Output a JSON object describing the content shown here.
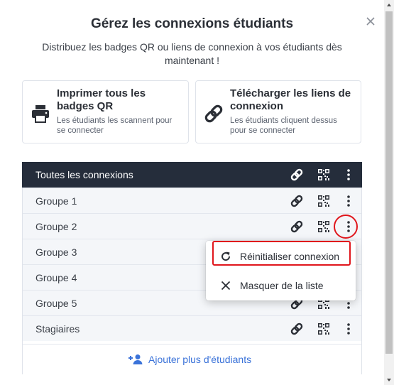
{
  "modal": {
    "title": "Gérez les connexions étudiants",
    "subtitle": "Distribuez les badges QR ou liens de connexion à vos étudiants dès maintenant !"
  },
  "cards": {
    "print": {
      "title": "Imprimer tous les badges QR",
      "description": "Les étudiants les scannent pour se connecter",
      "icon": "printer-icon"
    },
    "download": {
      "title": "Télécharger les liens de connexion",
      "description": "Les étudiants cliquent dessus pour se connecter",
      "icon": "link-icon"
    }
  },
  "table": {
    "header_label": "Toutes les connexions",
    "rows": [
      {
        "label": "Groupe 1"
      },
      {
        "label": "Groupe 2"
      },
      {
        "label": "Groupe 3"
      },
      {
        "label": "Groupe 4"
      },
      {
        "label": "Groupe 5"
      },
      {
        "label": "Stagiaires"
      }
    ],
    "add_label": "Ajouter plus d'étudiants"
  },
  "context_menu": {
    "items": [
      {
        "label": "Réinitialiser connexion",
        "icon": "refresh-icon"
      },
      {
        "label": "Masquer de la liste",
        "icon": "close-icon"
      }
    ]
  },
  "colors": {
    "header_bg": "#252d3b",
    "row_bg": "#f4f6f9",
    "accent_blue": "#3b73d9",
    "highlight_red": "#e0161c"
  }
}
